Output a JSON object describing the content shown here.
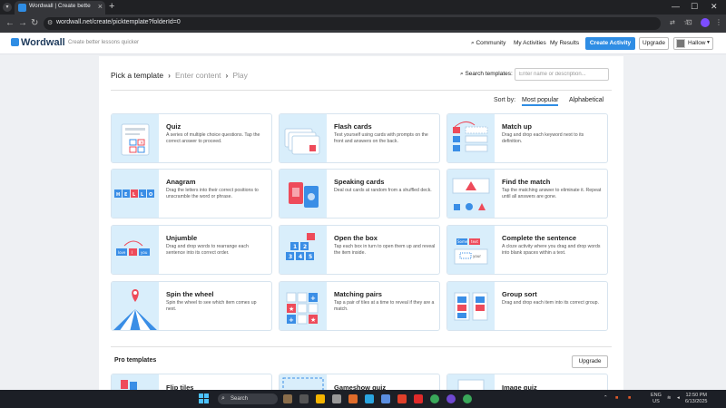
{
  "browser": {
    "tab_title": "Wordwall | Create better lessons",
    "url": "wordwall.net/create/picktemplate?folderId=0"
  },
  "header": {
    "logo": "Wordwall",
    "tagline": "Create better lessons quicker",
    "nav": {
      "community": "Community",
      "my_activities": "My Activities",
      "my_results": "My Results"
    },
    "create_activity": "Create Activity",
    "upgrade": "Upgrade",
    "user": "Hallow"
  },
  "steps": {
    "pick": "Pick a template",
    "enter": "Enter content",
    "play": "Play"
  },
  "search": {
    "label": "Search templates:",
    "placeholder": "Enter name or description..."
  },
  "sort": {
    "label": "Sort by:",
    "most_popular": "Most popular",
    "alphabetical": "Alphabetical"
  },
  "templates": [
    {
      "title": "Quiz",
      "desc": "A series of multiple choice questions. Tap the correct answer to proceed."
    },
    {
      "title": "Flash cards",
      "desc": "Test yourself using cards with prompts on the front and answers on the back."
    },
    {
      "title": "Match up",
      "desc": "Drag and drop each keyword next to its definition."
    },
    {
      "title": "Anagram",
      "desc": "Drag the letters into their correct positions to unscramble the word or phrase."
    },
    {
      "title": "Speaking cards",
      "desc": "Deal out cards at random from a shuffled deck."
    },
    {
      "title": "Find the match",
      "desc": "Tap the matching answer to eliminate it. Repeat until all answers are gone."
    },
    {
      "title": "Unjumble",
      "desc": "Drag and drop words to rearrange each sentence into its correct order."
    },
    {
      "title": "Open the box",
      "desc": "Tap each box in turn to open them up and reveal the item inside."
    },
    {
      "title": "Complete the sentence",
      "desc": "A cloze activity where you drag and drop words into blank spaces within a text."
    },
    {
      "title": "Spin the wheel",
      "desc": "Spin the wheel to see which item comes up next."
    },
    {
      "title": "Matching pairs",
      "desc": "Tap a pair of tiles at a time to reveal if they are a match."
    },
    {
      "title": "Group sort",
      "desc": "Drag and drop each item into its correct group."
    }
  ],
  "pro": {
    "label": "Pro templates",
    "upgrade": "Upgrade",
    "templates": [
      {
        "title": "Flip tiles"
      },
      {
        "title": "Gameshow quiz"
      },
      {
        "title": "Image quiz"
      }
    ]
  },
  "thumb_text": {
    "anagram": [
      "H",
      "E",
      "L",
      "L",
      "O"
    ],
    "unjumble": [
      "love",
      "I",
      "you"
    ],
    "open_box": [
      "1",
      "2",
      "3",
      "4",
      "5"
    ],
    "complete": [
      "Some",
      "text",
      "your"
    ]
  },
  "taskbar": {
    "search": "Search",
    "lang": "ENG",
    "region": "US",
    "time": "12:50 PM",
    "date": "6/13/2025"
  },
  "colors": {
    "accent": "#2f8de4",
    "thumb_bg": "#d9eefb",
    "red": "#ee4b5a"
  }
}
